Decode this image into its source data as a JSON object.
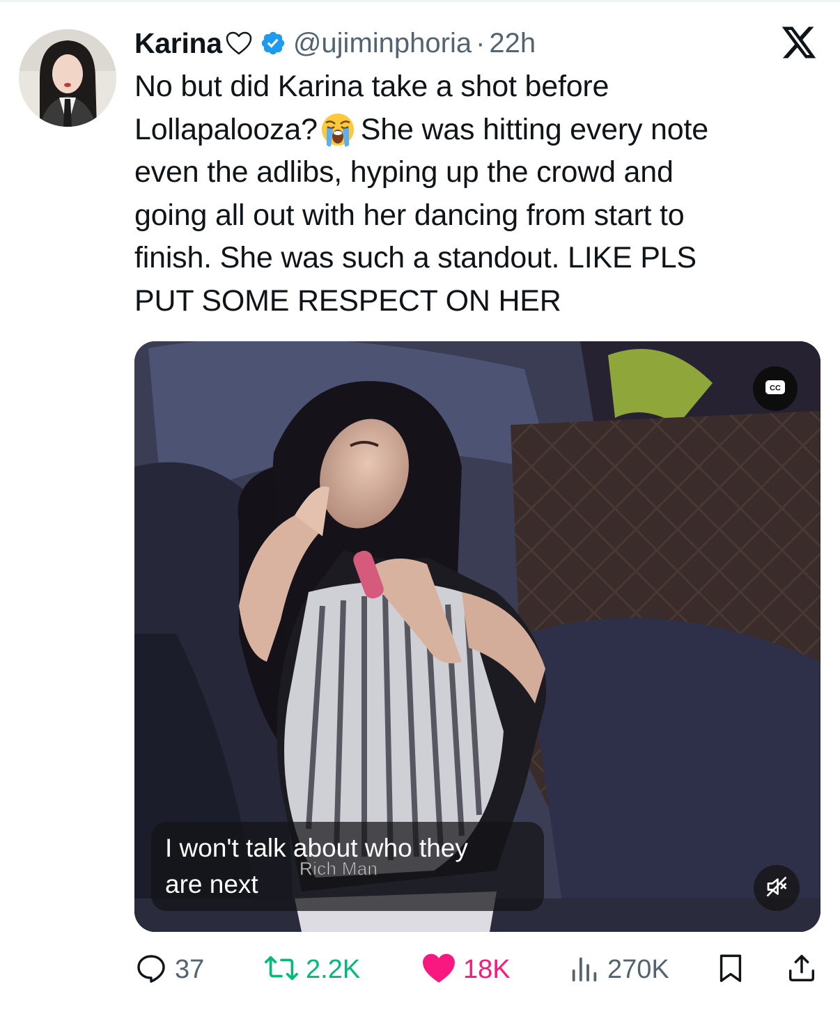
{
  "tweet": {
    "author": {
      "display_name": "Karina",
      "name_emoji": "♡",
      "verified": true,
      "handle": "@ujiminphoria",
      "separator": "·",
      "time": "22h",
      "avatar_icon": "avatar-photo"
    },
    "brand_icon": "x-logo-icon",
    "text_lines": [
      "No but did Karina take a shot before",
      "Lollapalooza?",
      "She was hitting every note",
      "even the adlibs, hyping up the crowd and",
      "going all out with her dancing from start to",
      "finish. She was such a standout. LIKE PLS",
      "PUT SOME RESPECT ON HER"
    ],
    "inline_emoji": "loudly-crying-face-emoji"
  },
  "video": {
    "caption_line1": "I won't talk about who they",
    "caption_line2": "are next",
    "watermark": "Rich Man",
    "cc_icon": "closed-captions-icon",
    "mute_icon": "speaker-muted-icon"
  },
  "actions": {
    "replies": "37",
    "reposts": "2.2K",
    "likes": "18K",
    "views": "270K",
    "reply_icon": "reply-icon",
    "repost_icon": "repost-icon",
    "like_icon": "heart-filled-icon",
    "views_icon": "views-bar-chart-icon",
    "bookmark_icon": "bookmark-icon",
    "share_icon": "share-icon"
  },
  "colors": {
    "text": "#0f1419",
    "secondary": "#536471",
    "verified": "#1d9bf0",
    "repost": "#00ba7c",
    "like": "#f91880"
  }
}
